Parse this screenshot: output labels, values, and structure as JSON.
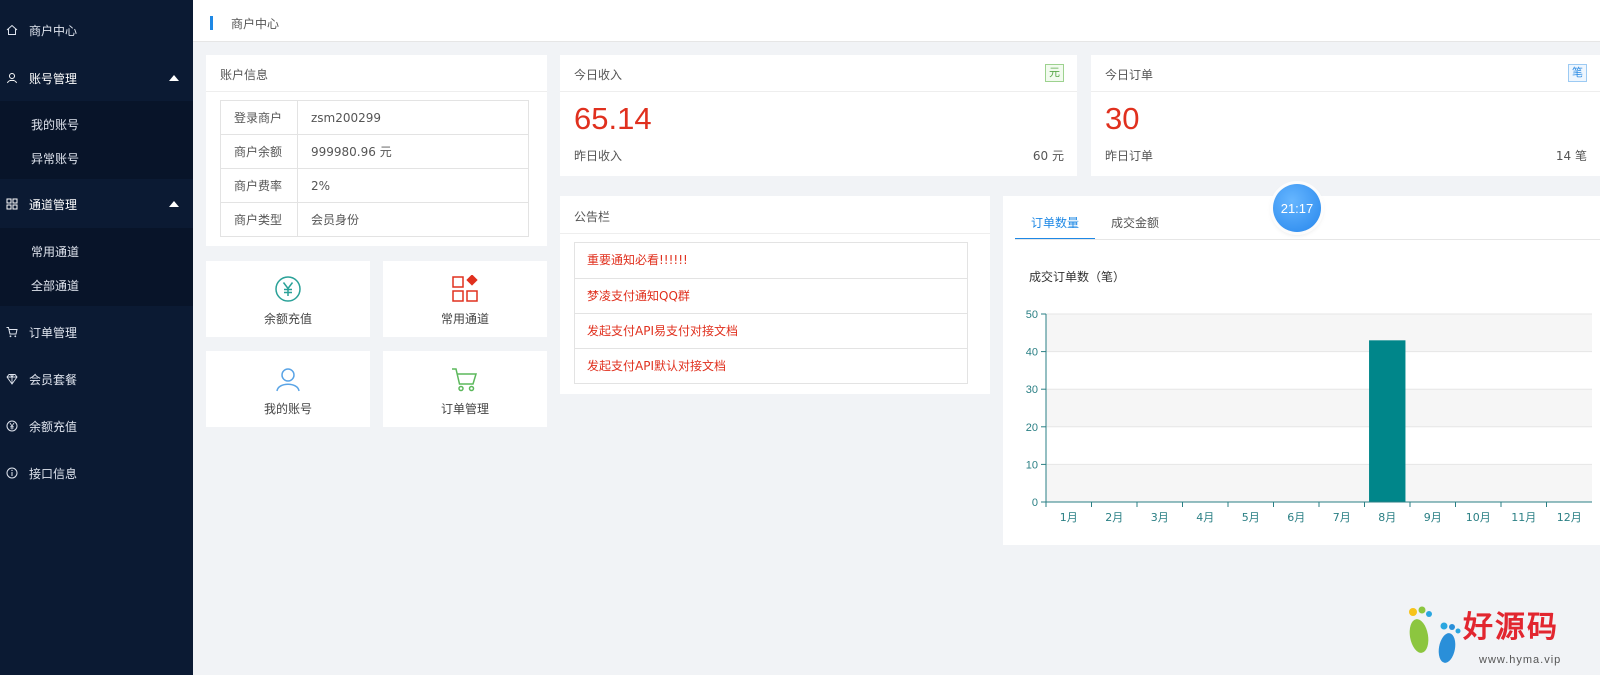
{
  "sidebar": {
    "items": [
      {
        "label": "商户中心",
        "icon": "home-icon"
      },
      {
        "label": "账号管理",
        "icon": "user-icon"
      },
      {
        "label": "通道管理",
        "icon": "grid-icon"
      },
      {
        "label": "订单管理",
        "icon": "cart-icon"
      },
      {
        "label": "会员套餐",
        "icon": "diamond-icon"
      },
      {
        "label": "余额充值",
        "icon": "yen-icon"
      },
      {
        "label": "接口信息",
        "icon": "info-icon"
      }
    ],
    "account_sub": [
      "我的账号",
      "异常账号"
    ],
    "channel_sub": [
      "常用通道",
      "全部通道"
    ]
  },
  "topbar": {
    "breadcrumb": "商户中心"
  },
  "account_info": {
    "title": "账户信息",
    "rows": [
      {
        "key": "登录商户",
        "value": "zsm200299"
      },
      {
        "key": "商户余额",
        "value": "999980.96 元"
      },
      {
        "key": "商户费率",
        "value": "2%"
      },
      {
        "key": "商户类型",
        "value": "会员身份"
      }
    ]
  },
  "quick_links": [
    {
      "label": "余额充值",
      "icon": "yen-circle-icon"
    },
    {
      "label": "常用通道",
      "icon": "squares-icon"
    },
    {
      "label": "我的账号",
      "icon": "user-outline-icon"
    },
    {
      "label": "订单管理",
      "icon": "cart-icon"
    }
  ],
  "today_income": {
    "title": "今日收入",
    "badge": "元",
    "value": "65.14",
    "sub_label": "昨日收入",
    "sub_value": "60 元"
  },
  "today_orders": {
    "title": "今日订单",
    "badge": "笔",
    "value": "30",
    "sub_label": "昨日订单",
    "sub_value": "14 笔"
  },
  "notice": {
    "title": "公告栏",
    "items": [
      "重要通知必看!!!!!!",
      "梦凌支付通知QQ群",
      "发起支付API易支付对接文档",
      "发起支付API默认对接文档"
    ]
  },
  "chart_tabs": {
    "active": "订单数量",
    "other": "成交金额"
  },
  "time_bubble": "21:17",
  "watermark": {
    "text": "好源码",
    "url": "www.hyma.vip"
  },
  "colors": {
    "sidebar": "#0b1a33",
    "accent": "#1e88e5",
    "bar": "#00868a",
    "red": "#e0301e"
  },
  "chart_data": {
    "type": "bar",
    "title": "成交订单数（笔）",
    "categories": [
      "1月",
      "2月",
      "3月",
      "4月",
      "5月",
      "6月",
      "7月",
      "8月",
      "9月",
      "10月",
      "11月",
      "12月"
    ],
    "values": [
      0,
      0,
      0,
      0,
      0,
      0,
      0,
      43,
      0,
      0,
      0,
      0
    ],
    "yticks": [
      0,
      10,
      20,
      30,
      40,
      50
    ],
    "ylim": [
      0,
      50
    ],
    "xlabel": "",
    "ylabel": "",
    "grid": true
  }
}
